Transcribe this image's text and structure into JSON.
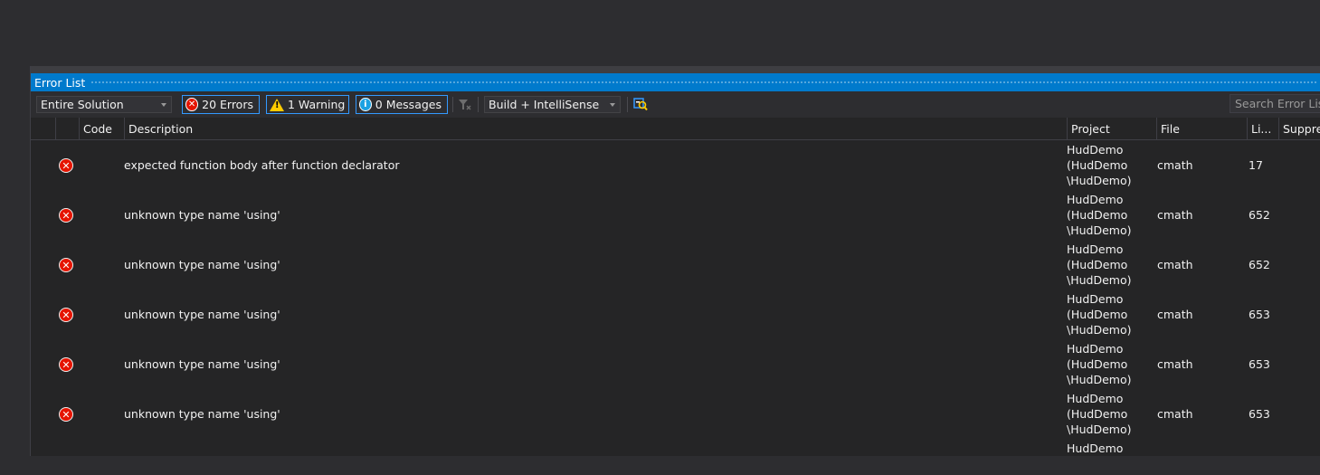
{
  "panel": {
    "title": "Error List"
  },
  "toolbar": {
    "scope": "Entire Solution",
    "errors_label": "20 Errors",
    "warnings_label": "1 Warning",
    "messages_label": "0 Messages",
    "build_filter": "Build + IntelliSense",
    "search_placeholder": "Search Error List"
  },
  "columns": {
    "code": "Code",
    "description": "Description",
    "project": "Project",
    "file": "File",
    "line": "Li...",
    "suppression": "Suppression State"
  },
  "rows": [
    {
      "description": "expected function body after function declarator",
      "project": [
        "HudDemo",
        "(HudDemo",
        "\\HudDemo)"
      ],
      "file": "cmath",
      "line": "17"
    },
    {
      "description": "unknown type name 'using'",
      "project": [
        "HudDemo",
        "(HudDemo",
        "\\HudDemo)"
      ],
      "file": "cmath",
      "line": "652"
    },
    {
      "description": "unknown type name 'using'",
      "project": [
        "HudDemo",
        "(HudDemo",
        "\\HudDemo)"
      ],
      "file": "cmath",
      "line": "652"
    },
    {
      "description": "unknown type name 'using'",
      "project": [
        "HudDemo",
        "(HudDemo",
        "\\HudDemo)"
      ],
      "file": "cmath",
      "line": "653"
    },
    {
      "description": "unknown type name 'using'",
      "project": [
        "HudDemo",
        "(HudDemo",
        "\\HudDemo)"
      ],
      "file": "cmath",
      "line": "653"
    },
    {
      "description": "unknown type name 'using'",
      "project": [
        "HudDemo",
        "(HudDemo",
        "\\HudDemo)"
      ],
      "file": "cmath",
      "line": "653"
    },
    {
      "description": "",
      "project": [
        "HudDemo"
      ],
      "file": "",
      "line": ""
    }
  ],
  "colors": {
    "accent": "#007acc",
    "error": "#e51400",
    "warning": "#ffcc00",
    "info": "#1ba1e2",
    "background": "#252526"
  }
}
